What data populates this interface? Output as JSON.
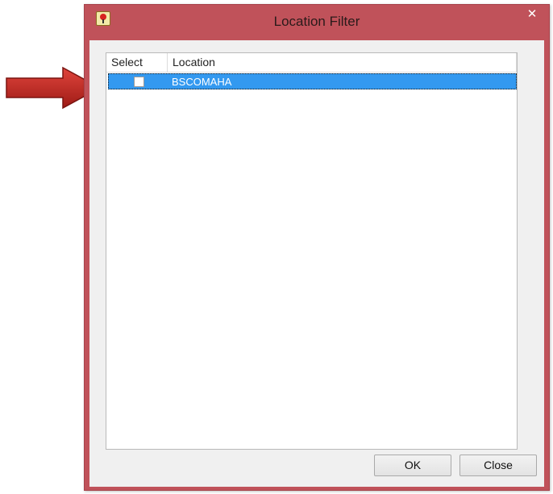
{
  "window": {
    "title": "Location Filter",
    "close_glyph": "✕",
    "accent_color": "#c0525a"
  },
  "grid": {
    "columns": [
      "Select",
      "Location"
    ],
    "rows": [
      {
        "selected": false,
        "location": "BSCOMAHA"
      }
    ],
    "highlight_color": "#3399f0"
  },
  "buttons": {
    "ok_label": "OK",
    "close_label": "Close"
  },
  "icons": {
    "app": "map-pin-icon",
    "close": "close-icon",
    "annotation": "red-arrow-icon"
  }
}
